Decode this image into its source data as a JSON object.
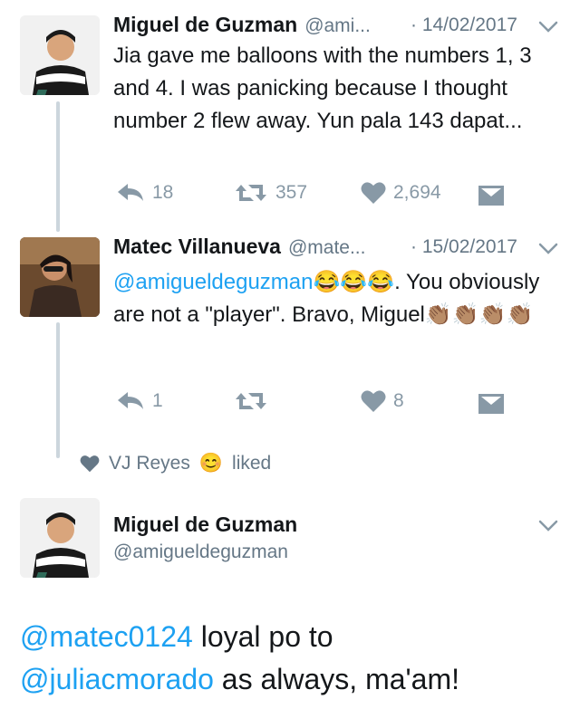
{
  "tweets": [
    {
      "name": "Miguel de Guzman",
      "handle": "@ami...",
      "date": "· 14/02/2017",
      "text": "Jia gave me balloons with the numbers 1, 3 and 4. I was panicking because I thought number 2 flew away. Yun pala 143 dapat...",
      "reply_count": "18",
      "retweet_count": "357",
      "like_count": "2,694"
    },
    {
      "name": "Matec Villanueva",
      "handle": "@mate...",
      "date": "· 15/02/2017",
      "mention": "@amigueldeguzman",
      "emoji_a": "😂😂😂",
      "text_a": ". You obviously are not a \"player\". Bravo, Miguel",
      "emoji_b": "👏🏽👏🏽👏🏽👏🏽",
      "reply_count": "1",
      "retweet_count": "",
      "like_count": "8"
    }
  ],
  "liked_by": {
    "name": "VJ Reyes",
    "emoji": "😊",
    "suffix": "liked"
  },
  "main_tweet": {
    "name": "Miguel de Guzman",
    "handle": "@amigueldeguzman",
    "mention_1": "@matec0124",
    "text_1": " loyal po to",
    "mention_2": "@juliacmorado",
    "text_2": " as always, ma'am!"
  },
  "colors": {
    "accent": "#1da1f2",
    "muted": "#657786",
    "icon": "#8899a6",
    "line": "#ccd6dd"
  }
}
